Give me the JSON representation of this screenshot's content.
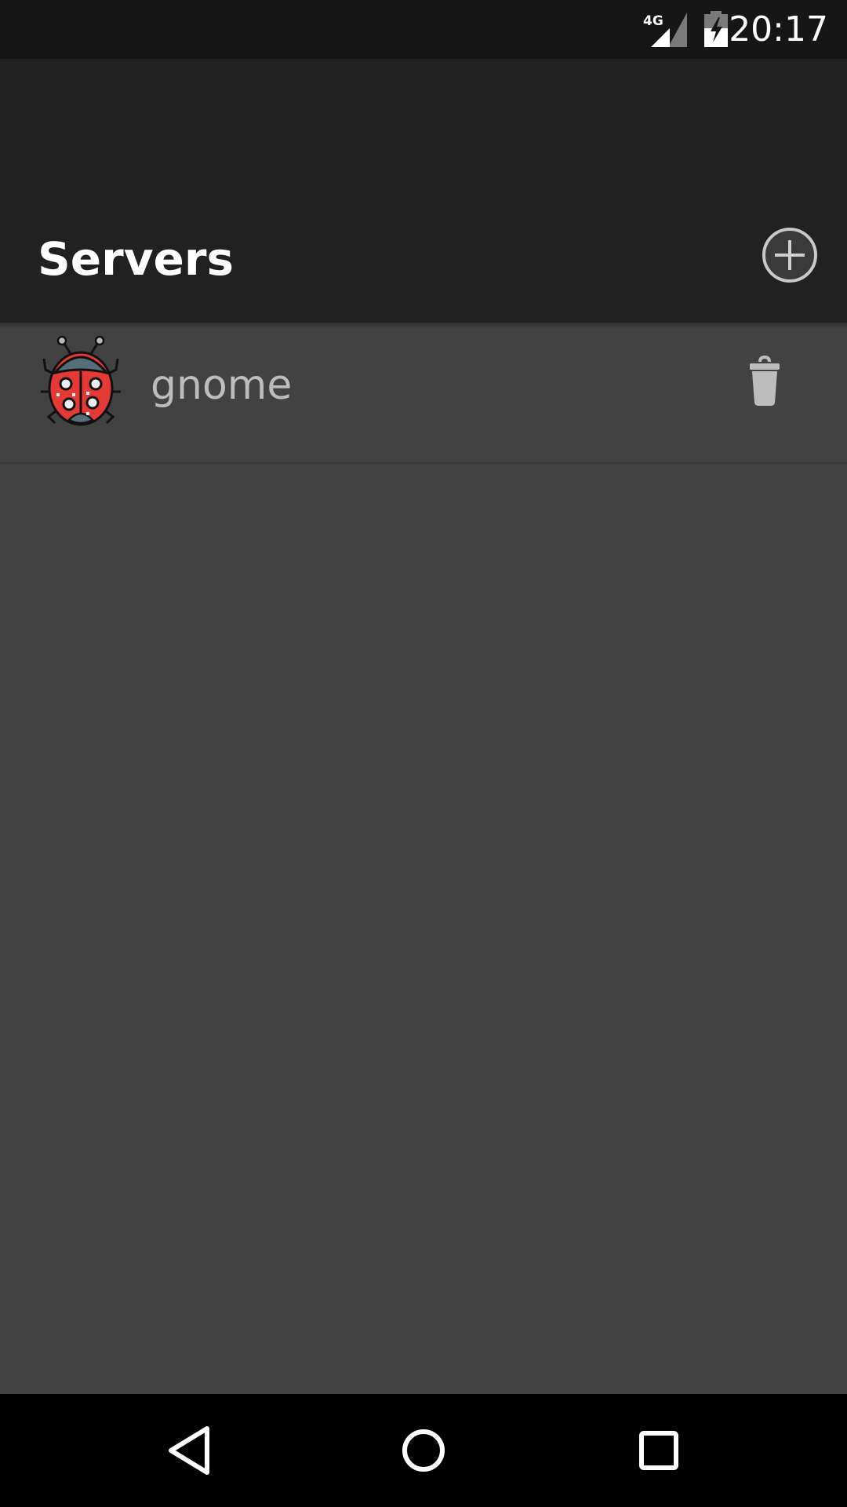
{
  "status_bar": {
    "network_label": "4G",
    "time": "20:17",
    "icons": [
      "signal-4g-icon",
      "battery-charging-icon"
    ]
  },
  "header": {
    "title": "Servers",
    "add_icon": "add-circle-icon"
  },
  "servers": [
    {
      "name": "gnome",
      "icon": "ladybug-icon",
      "delete_icon": "trash-icon"
    }
  ],
  "nav_bar": {
    "icons": [
      "back-icon",
      "home-icon",
      "recents-icon"
    ]
  },
  "colors": {
    "status_bar_bg": "#161616",
    "app_bar_bg": "#212121",
    "content_bg": "#424242",
    "nav_bar_bg": "#000000",
    "title_text": "#ffffff",
    "item_text": "#bdbdbd",
    "ladybug_red": "#e53935"
  }
}
